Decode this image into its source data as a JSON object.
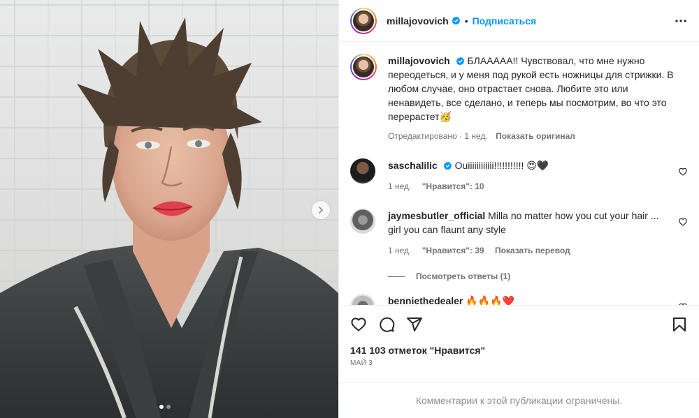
{
  "post": {
    "author": "millajovovich",
    "follow_label": "Подписаться",
    "separator": "•",
    "more_icon": "more-horizontal-icon",
    "caption": "БЛААААА!! Чувствовал, что мне нужно переодеться, и у меня под рукой есть ножницы для стрижки. В любом случае, оно отрастает снова. Любите это или ненавидеть, все сделано, и теперь мы посмотрим, во что это перерастет🥳",
    "caption_meta": "Отредактировано · 1 нед.",
    "show_original_label": "Показать оригинал",
    "likes_text": "141 103 отметок \"Нравится\"",
    "date_text": "МАЙ 3",
    "comments_limited_text": "Комментарии к этой публикации ограничены."
  },
  "comments": [
    {
      "username": "saschalilic",
      "verified": true,
      "text": "Ouiiiiiiiiiiii!!!!!!!!!!! 😍🖤",
      "time": "1 нед.",
      "likes": "\"Нравится\": 10",
      "translate_label": ""
    },
    {
      "username": "jaymesbutler_official",
      "verified": false,
      "text": "Milla no matter how you cut your hair ... girl you can flaunt any style",
      "time": "1 нед.",
      "likes": "\"Нравится\": 39",
      "translate_label": "Показать перевод"
    },
    {
      "username": "benniethedealer",
      "verified": false,
      "text": "🔥🔥🔥❤️"
    }
  ],
  "view_replies_label": "Посмотреть ответы (1)",
  "icons": {
    "like": "heart-icon",
    "comment": "comment-icon",
    "share": "share-icon",
    "save": "bookmark-icon",
    "next": "chevron-right-icon",
    "verified": "verified-badge-icon"
  },
  "colors": {
    "accent": "#0095f6",
    "text": "#262626",
    "secondary": "#737373",
    "border": "#efefef",
    "verified": "#0095f6"
  },
  "carousel": {
    "slides": 2,
    "current": 1
  }
}
